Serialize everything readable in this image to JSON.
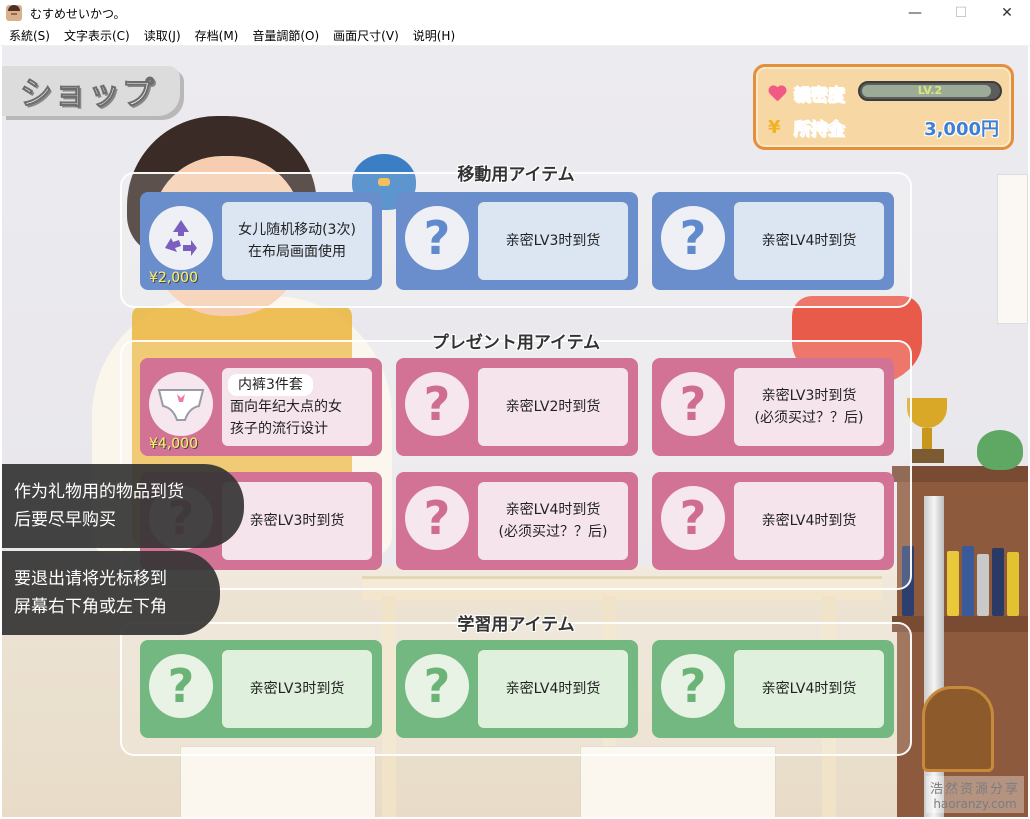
{
  "window": {
    "title": "むすめせいかつ。",
    "min_glyph": "—",
    "max_glyph": "☐",
    "close_glyph": "✕"
  },
  "menu": [
    "系統(S)",
    "文字表示(C)",
    "读取(J)",
    "存档(M)",
    "音量調節(O)",
    "画面尺寸(V)",
    "说明(H)"
  ],
  "shop_title": "ショップ",
  "status": {
    "affinity_label": "親密度",
    "level_text": "LV.2",
    "level_fraction": 0.95,
    "money_label": "所持金",
    "money_value": "3,000円"
  },
  "sections": [
    {
      "title": "移動用アイテム",
      "color": "#6a8ecb",
      "cards": [
        {
          "icon": "recycle-icon",
          "lines": [
            "女儿随机移动(3次)",
            "在布局画面使用"
          ],
          "price": "¥2,000"
        },
        {
          "icon": "question-icon",
          "lines": [
            "亲密LV3时到货"
          ]
        },
        {
          "icon": "question-icon",
          "lines": [
            "亲密LV4时到货"
          ]
        }
      ]
    },
    {
      "title": "プレゼント用アイテム",
      "color": "#d27294",
      "cards": [
        {
          "icon": "panty-icon",
          "name": "内裤3件套",
          "lines": [
            "面向年纪大点的女",
            "孩子的流行设计"
          ],
          "price": "¥4,000"
        },
        {
          "icon": "question-icon",
          "lines": [
            "亲密LV2时到货"
          ]
        },
        {
          "icon": "question-icon",
          "lines": [
            "亲密LV3时到货",
            "(必须买过？？后)"
          ]
        },
        {
          "icon": "question-icon",
          "lines": [
            "亲密LV3时到货"
          ]
        },
        {
          "icon": "question-icon",
          "lines": [
            "亲密LV4时到货",
            "(必须买过？？后)"
          ]
        },
        {
          "icon": "question-icon",
          "lines": [
            "亲密LV4时到货"
          ]
        }
      ]
    },
    {
      "title": "学習用アイテム",
      "color": "#74b881",
      "cards": [
        {
          "icon": "question-icon",
          "lines": [
            "亲密LV3时到货"
          ]
        },
        {
          "icon": "question-icon",
          "lines": [
            "亲密LV4时到货"
          ]
        },
        {
          "icon": "question-icon",
          "lines": [
            "亲密LV4时到货"
          ]
        }
      ]
    }
  ],
  "tooltips": [
    [
      "作为礼物用的物品到货",
      "后要尽早购买"
    ],
    [
      "要退出请将光标移到",
      "屏幕右下角或左下角"
    ]
  ],
  "watermark": {
    "line1": "浩然资源分享",
    "line2": "haoranzy.com"
  }
}
